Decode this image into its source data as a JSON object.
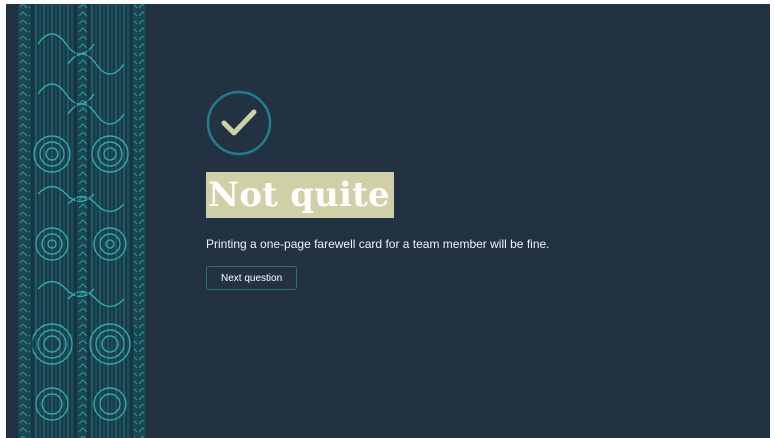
{
  "result": {
    "icon": "check-circle-icon",
    "title": "Not quite",
    "message": "Printing a one-page farewell card for a team member will be fine."
  },
  "actions": {
    "next_label": "Next question"
  },
  "colors": {
    "background": "#233242",
    "accent": "#1f7f88",
    "title_highlight": "#cfd0a6",
    "check_mark": "#cfd0a6"
  },
  "decor": {
    "pattern_icon": "maori-kowhaiwhai-pattern"
  }
}
